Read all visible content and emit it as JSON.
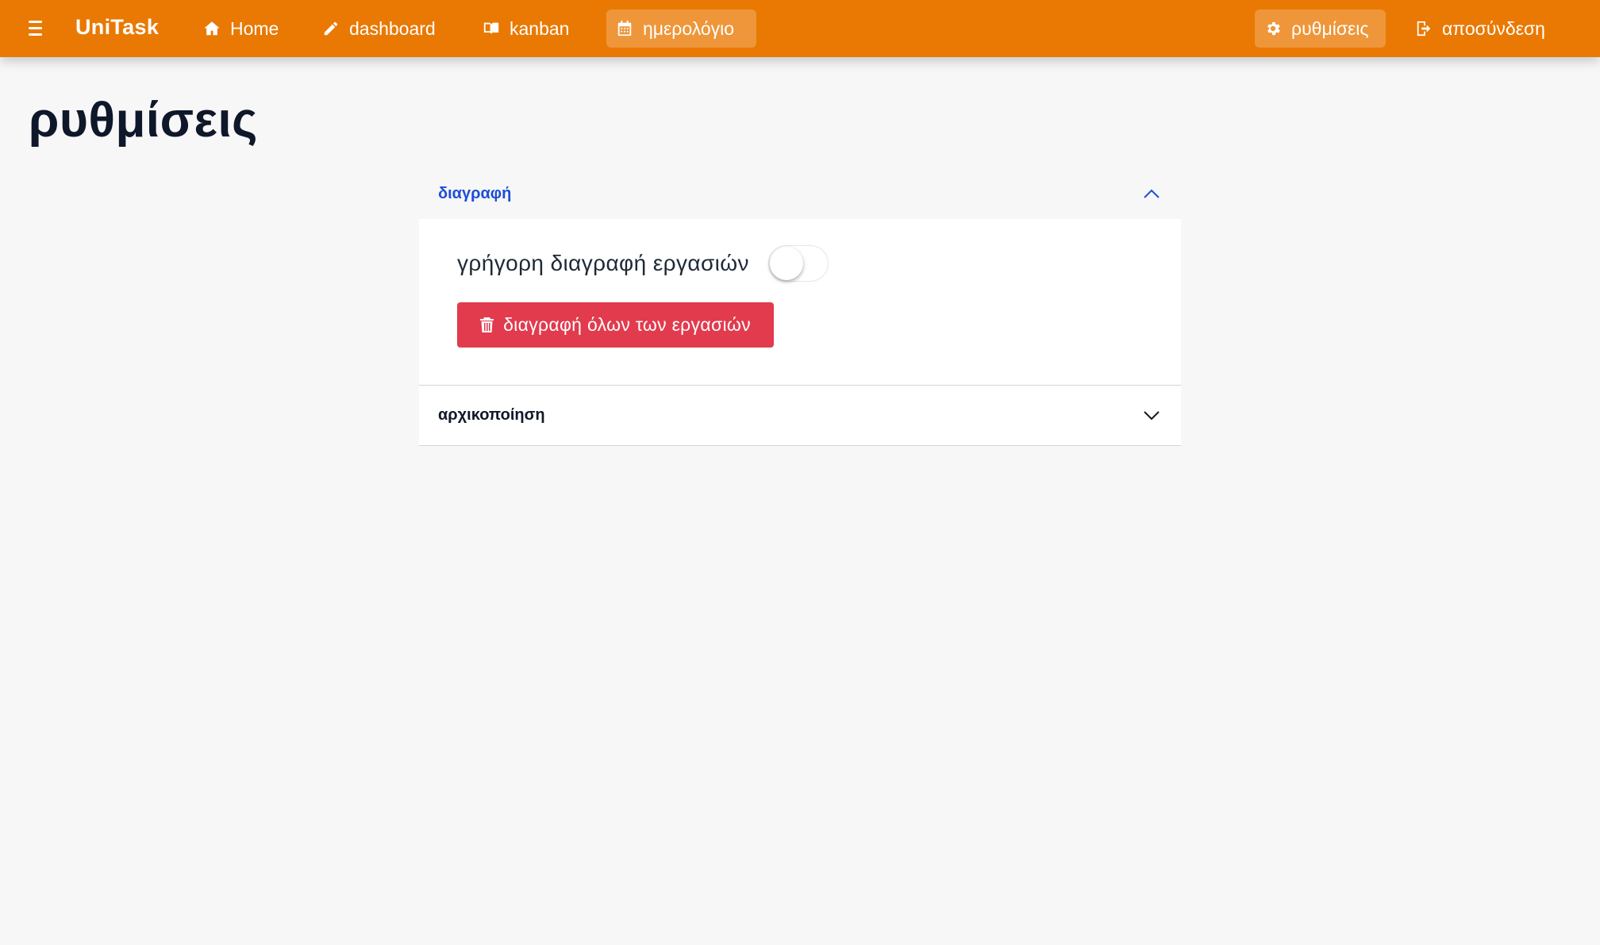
{
  "navbar": {
    "brand": "UniTask",
    "items": [
      {
        "label": "Home",
        "icon": "home-icon"
      },
      {
        "label": "dashboard",
        "icon": "pencil-icon"
      },
      {
        "label": "kanban",
        "icon": "book-icon"
      },
      {
        "label": "ημερολόγιο",
        "icon": "calendar-icon",
        "active": true
      }
    ],
    "right_items": [
      {
        "label": "ρυθμίσεις",
        "icon": "gear-icon",
        "active": true
      },
      {
        "label": "αποσύνδεση",
        "icon": "logout-icon"
      }
    ]
  },
  "page": {
    "title": "ρυθμίσεις"
  },
  "accordion": {
    "sections": [
      {
        "title": "διαγραφή",
        "expanded": true,
        "toggle_label": "γρήγορη διαγραφή εργασιών",
        "toggle_on": false,
        "button_label": "διαγραφή όλων των εργασιών",
        "button_icon": "trash-icon"
      },
      {
        "title": "αρχικοποίηση",
        "expanded": false
      }
    ]
  },
  "colors": {
    "navbar": "#e97902",
    "accent": "#1d4ed8",
    "danger": "#e23b4e",
    "background": "#f7f7f7"
  }
}
